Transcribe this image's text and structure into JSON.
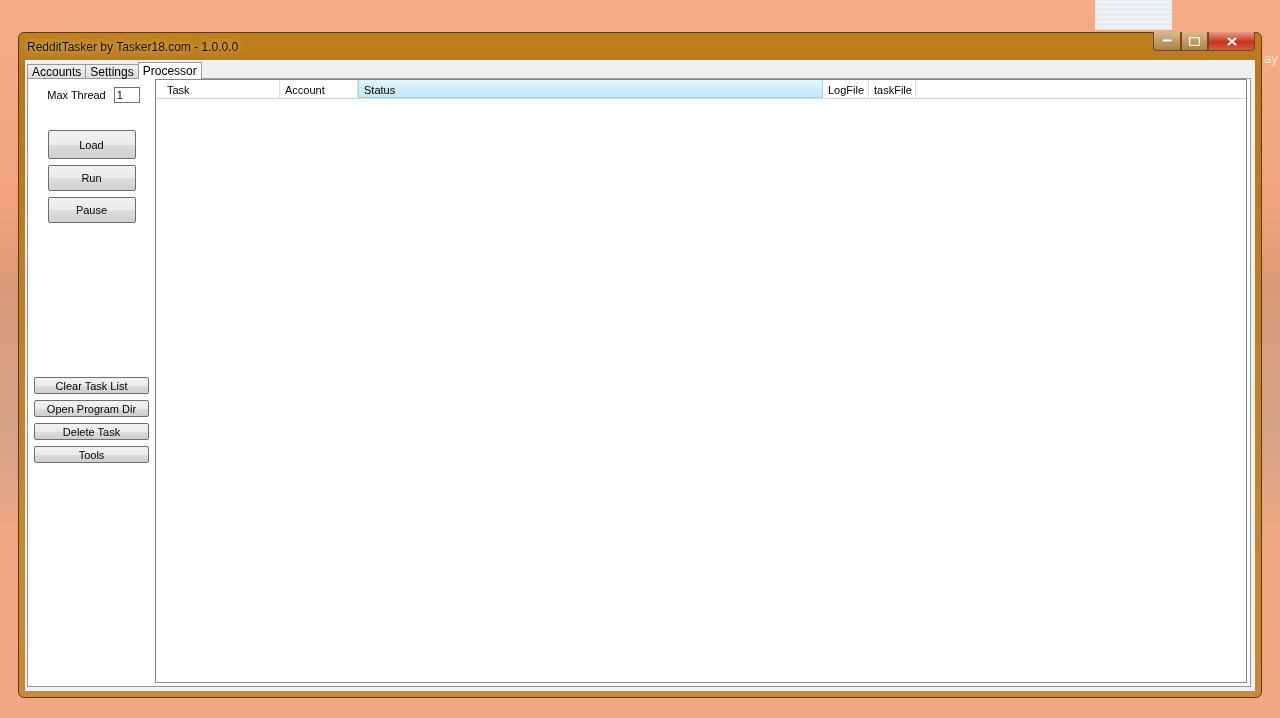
{
  "desktop": {
    "edge_text": "ay"
  },
  "window": {
    "title": "RedditTasker by Tasker18.com - 1.0.0.0"
  },
  "tabs": [
    {
      "label": "Accounts",
      "selected": false
    },
    {
      "label": "Settings",
      "selected": false
    },
    {
      "label": "Processor",
      "selected": true
    }
  ],
  "max_thread": {
    "label": "Max Thread",
    "value": "1"
  },
  "main_buttons": [
    "Load",
    "Run",
    "Pause"
  ],
  "tool_buttons": [
    "Clear Task List",
    "Open Program Dir",
    "Delete Task",
    "Tools"
  ],
  "table": {
    "columns": [
      {
        "label": "Task",
        "selected": false
      },
      {
        "label": "Account",
        "selected": false
      },
      {
        "label": "Status",
        "selected": true
      },
      {
        "label": "LogFile",
        "selected": false
      },
      {
        "label": "taskFile",
        "selected": false
      }
    ]
  }
}
